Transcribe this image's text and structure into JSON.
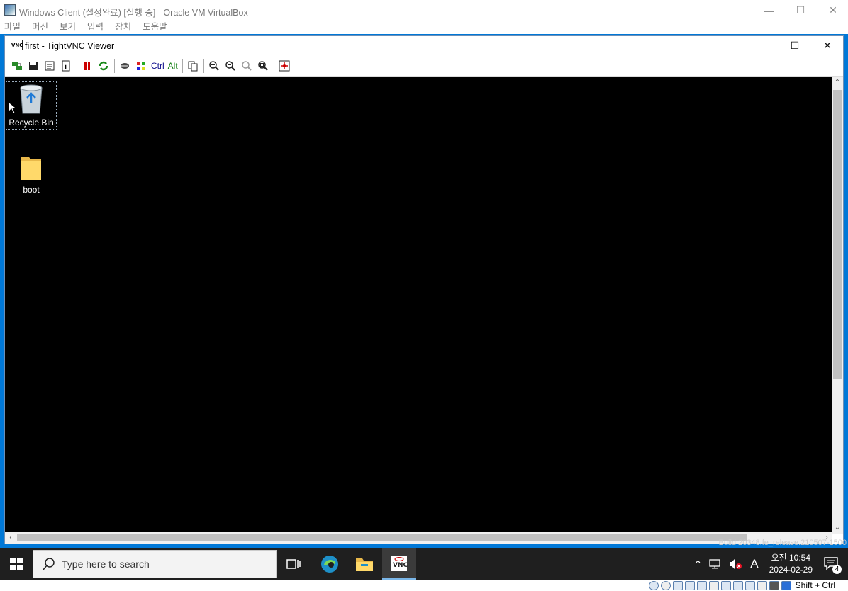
{
  "vbox": {
    "title": "Windows Client (설정완료) [실행 중] - Oracle VM VirtualBox",
    "menu": [
      "파일",
      "머신",
      "보기",
      "입력",
      "장치",
      "도움말"
    ],
    "host_key": "Shift + Ctrl"
  },
  "vnc": {
    "title": "first - TightVNC Viewer",
    "toolbar_ctrl": "Ctrl",
    "toolbar_alt": "Alt"
  },
  "desktop": {
    "icons": [
      {
        "label": "Recycle Bin",
        "icon": "recycle-bin-icon"
      },
      {
        "label": "boot",
        "icon": "folder-icon"
      }
    ],
    "build_text": "Build 20348.fe_release.210507-1500"
  },
  "taskbar": {
    "search_placeholder": "Type here to search",
    "clock_time": "오전 10:54",
    "clock_date": "2024-02-29",
    "ime": "A",
    "notification_count": "4"
  },
  "colors": {
    "accent": "#0078d7",
    "taskbar": "#1f1f1f"
  }
}
